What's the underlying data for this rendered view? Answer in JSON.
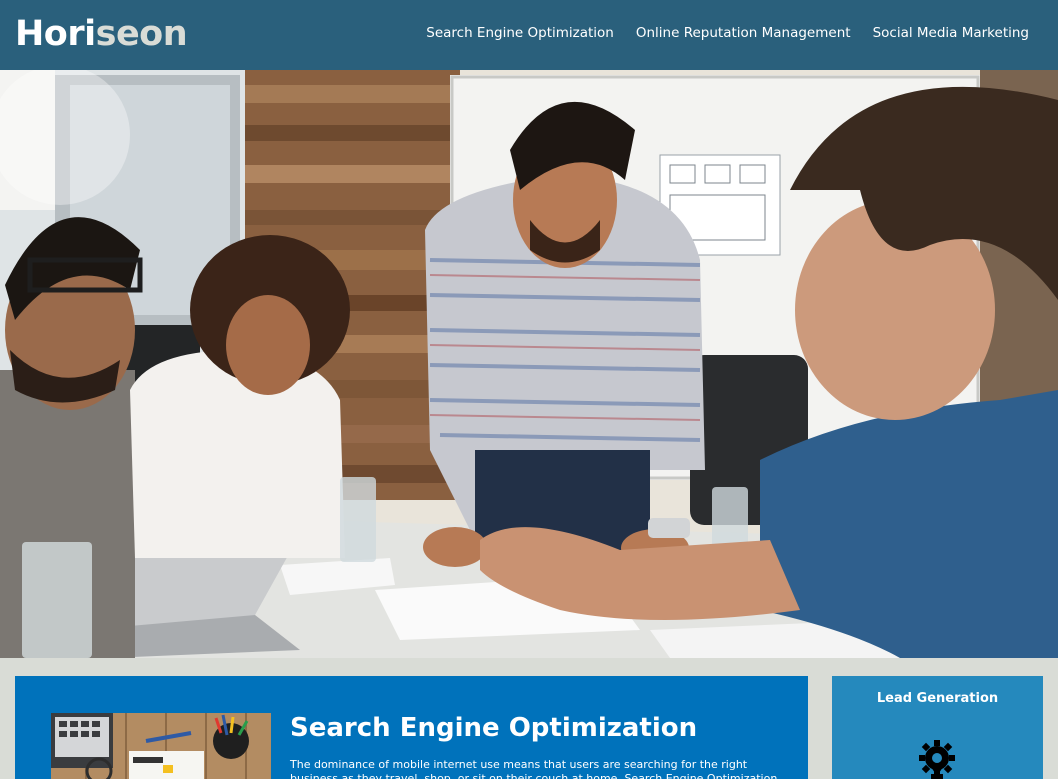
{
  "header": {
    "logo_main": "Hori",
    "logo_accent": "seon",
    "nav": [
      {
        "label": "Search Engine Optimization"
      },
      {
        "label": "Online Reputation Management"
      },
      {
        "label": "Social Media Marketing"
      }
    ]
  },
  "content": {
    "seo": {
      "title": "Search Engine Optimization",
      "body": "The dominance of mobile internet use means that users are searching for the right business as they travel, shop, or sit on their couch at home. Search Engine Optimization (SEO) allows you to increase"
    }
  },
  "benefits": {
    "lead_generation": {
      "title": "Lead Generation"
    }
  },
  "colors": {
    "header_bg": "#2a607c",
    "page_bg": "#d9dcd6",
    "content_bg": "#0072bb",
    "benefit_bg": "#2589bd",
    "text": "#ffffff"
  }
}
